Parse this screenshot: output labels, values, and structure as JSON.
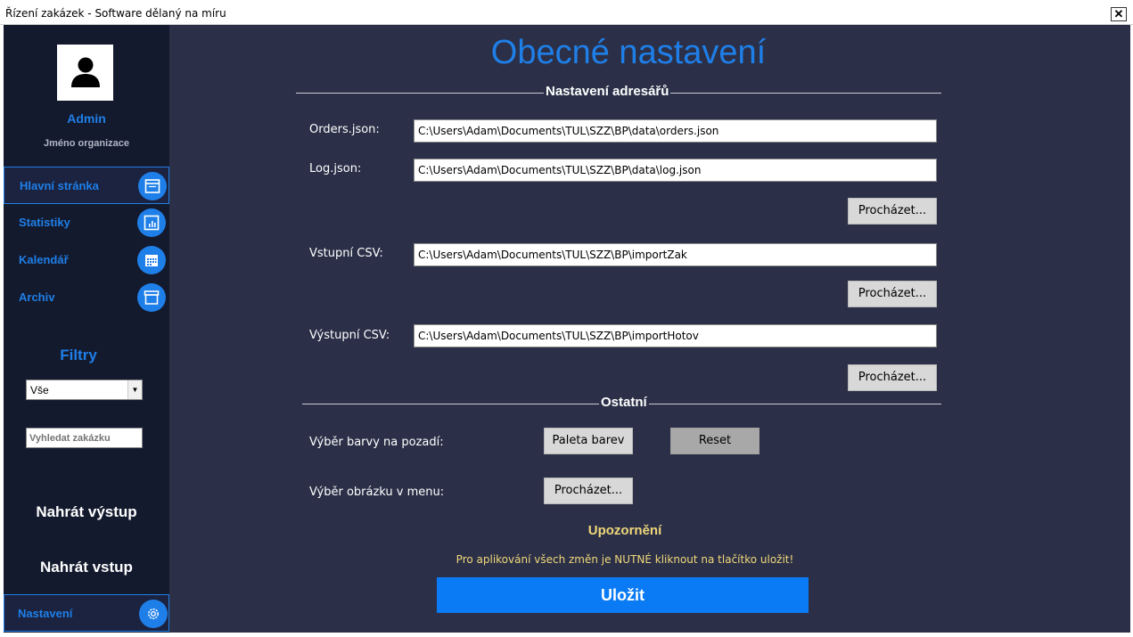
{
  "window": {
    "title": "Řízení zakázek - Software dělaný na míru",
    "close_label": "✕"
  },
  "sidebar": {
    "user_name": "Admin",
    "organization": "Jméno organizace",
    "nav": [
      {
        "label": "Hlavní stránka",
        "icon": "window-icon"
      },
      {
        "label": "Statistiky",
        "icon": "chart-icon"
      },
      {
        "label": "Kalendář",
        "icon": "calendar-icon"
      },
      {
        "label": "Archiv",
        "icon": "archive-icon"
      }
    ],
    "filters_title": "Filtry",
    "filter_selected": "Vše",
    "search_placeholder": "Vyhledat zakázku",
    "upload_output": "Nahrát výstup",
    "upload_input": "Nahrát vstup",
    "settings_label": "Nastavení"
  },
  "main": {
    "title": "Obecné nastavení",
    "section_dirs": "Nastavení adresářů",
    "section_other": "Ostatní",
    "fields": [
      {
        "label": "Orders.json:",
        "value": "C:\\Users\\Adam\\Documents\\TUL\\SZZ\\BP\\data\\orders.json"
      },
      {
        "label": "Log.json:",
        "value": "C:\\Users\\Adam\\Documents\\TUL\\SZZ\\BP\\data\\log.json"
      },
      {
        "label": "Vstupní CSV:",
        "value": "C:\\Users\\Adam\\Documents\\TUL\\SZZ\\BP\\importZak"
      },
      {
        "label": "Výstupní CSV:",
        "value": "C:\\Users\\Adam\\Documents\\TUL\\SZZ\\BP\\importHotov"
      }
    ],
    "browse_label": "Procházet...",
    "bg_color_label": "Výběr barvy na pozadí:",
    "palette_label": "Paleta barev",
    "reset_label": "Reset",
    "menu_image_label": "Výběr obrázku v menu:",
    "warning_title": "Upozornění",
    "warning_text": "Pro aplikování všech změn je NUTNÉ kliknout na tlačítko uložit!",
    "save_label": "Uložit"
  },
  "colors": {
    "accent": "#1f7fe8",
    "sidebar_bg": "#141a2e",
    "main_bg": "#2b3048",
    "warning": "#f0d77a",
    "save_button": "#0a7bf5"
  }
}
